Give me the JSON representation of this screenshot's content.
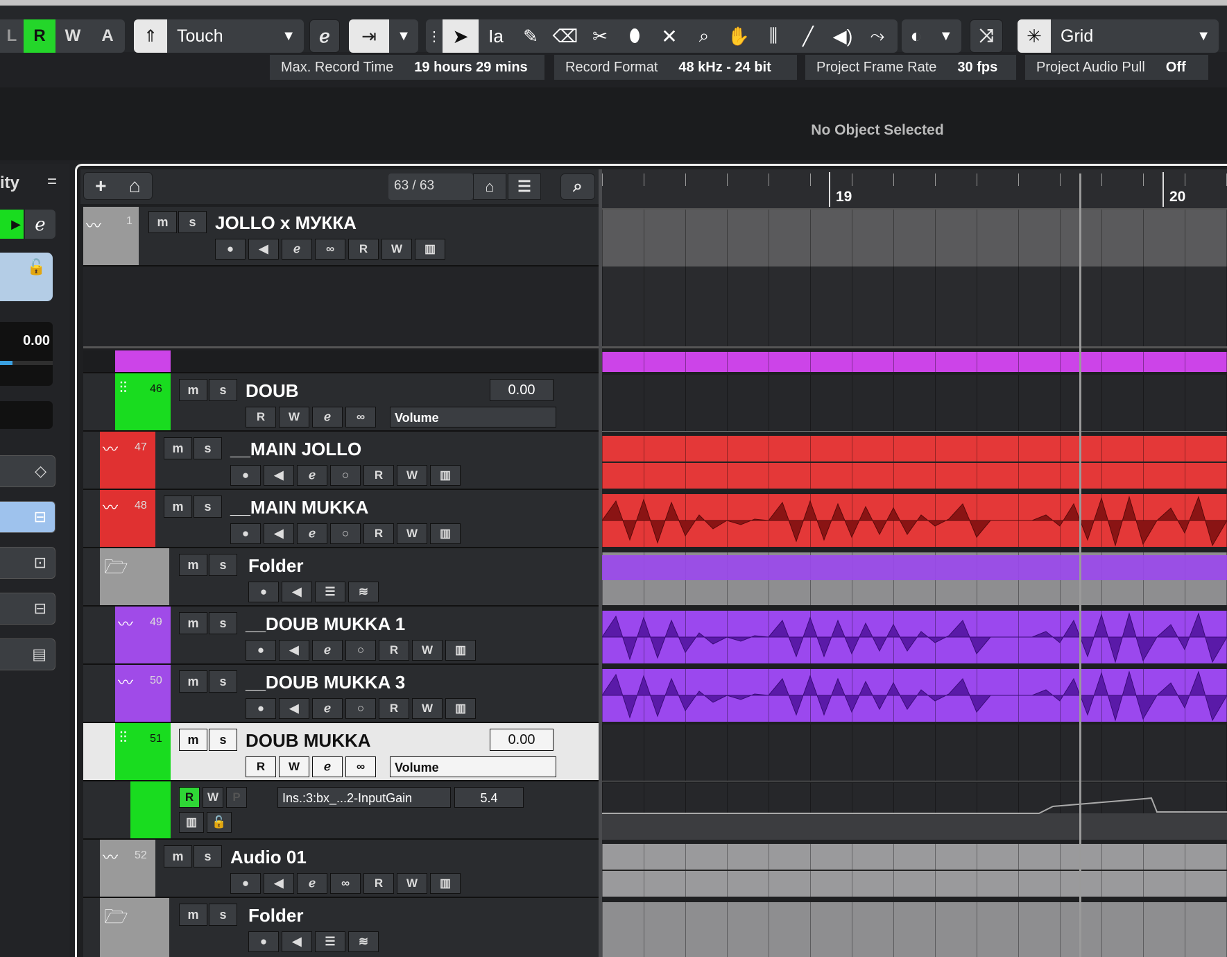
{
  "toolbar": {
    "automation_modes": [
      "L",
      "R",
      "W",
      "A"
    ],
    "automation_mode_select": "Touch",
    "snap_type": "Grid",
    "tool_icons": [
      "object-selection-icon",
      "range-icon",
      "draw-icon",
      "erase-icon",
      "split-icon",
      "glue-icon",
      "mute-icon",
      "zoom-icon",
      "hand-icon",
      "comp-icon",
      "line-icon",
      "play-icon",
      "color-icon"
    ]
  },
  "info_line": {
    "items": [
      {
        "label": "Max. Record Time",
        "value": "19 hours 29 mins"
      },
      {
        "label": "Record Format",
        "value": "48 kHz - 24 bit"
      },
      {
        "label": "Project Frame Rate",
        "value": "30 fps"
      },
      {
        "label": "Project Audio Pull",
        "value": "Off"
      }
    ]
  },
  "status": {
    "no_selection": "No Object Selected"
  },
  "inspector": {
    "title_fragment": "ity",
    "volume": "0.00"
  },
  "tracklist": {
    "count": "63 / 63",
    "ruler": {
      "bar_a": "19",
      "bar_b": "20"
    },
    "tracks": [
      {
        "num": "1",
        "name": "JOLLO x МУККА",
        "color": "#9a9a9a",
        "type": "audio"
      },
      {
        "num": "46",
        "name": "DOUB",
        "color": "#19dc1f",
        "type": "fx",
        "value": "0.00",
        "param": "Volume"
      },
      {
        "num": "47",
        "name": "__MAIN JOLLO",
        "color": "#e03131",
        "type": "audio"
      },
      {
        "num": "48",
        "name": "__MAIN MUKKA",
        "color": "#e03131",
        "type": "audio"
      },
      {
        "num": "",
        "name": "Folder",
        "color": "#9a9a9a",
        "type": "folder"
      },
      {
        "num": "49",
        "name": "__DOUB MUKKA 1",
        "color": "#a04be8",
        "type": "audio"
      },
      {
        "num": "50",
        "name": "__DOUB MUKKA 3",
        "color": "#a04be8",
        "type": "audio"
      },
      {
        "num": "51",
        "name": "DOUB MUKKA",
        "color": "#19dc1f",
        "type": "fx",
        "value": "0.00",
        "param": "Volume"
      },
      {
        "num": "",
        "name": "Ins.:3:bx_...2-InputGain",
        "color": "#19dc1f",
        "type": "automation",
        "value": "5.4"
      },
      {
        "num": "52",
        "name": "Audio 01",
        "color": "#9a9a9a",
        "type": "audio"
      },
      {
        "num": "",
        "name": "Folder",
        "color": "#9a9a9a",
        "type": "folder"
      }
    ]
  },
  "colors": {
    "purple": "#cc44e8",
    "red": "#e03434",
    "violet": "#9b48ee",
    "green": "#19dc1f"
  }
}
